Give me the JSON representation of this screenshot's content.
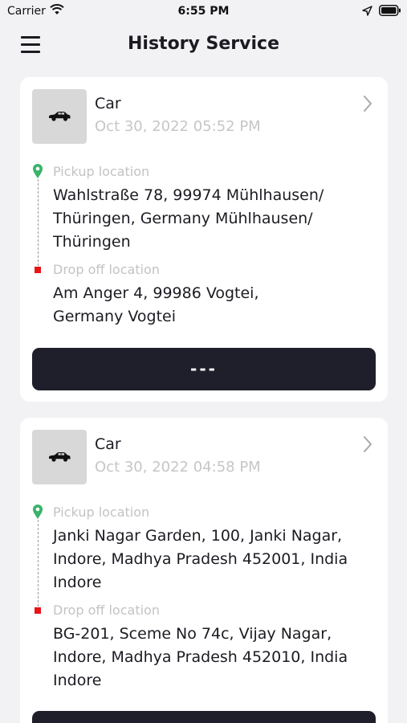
{
  "status_bar": {
    "carrier": "Carrier",
    "time": "6:55 PM"
  },
  "header": {
    "title": "History Service",
    "menu_icon": "hamburger-menu-icon"
  },
  "trips": [
    {
      "vehicle": "Car",
      "date": "Oct 30, 2022 05:52 PM",
      "pickup_label": "Pickup location",
      "pickup_address_lines": [
        "Wahlstraße 78, 99974 Mühlhausen/",
        "Thüringen, Germany Mühlhausen/",
        "Thüringen"
      ],
      "dropoff_label": "Drop off location",
      "dropoff_address_lines": [
        "Am Anger 4, 99986 Vogtei,",
        "Germany Vogtei"
      ],
      "action_label": "---"
    },
    {
      "vehicle": "Car",
      "date": "Oct 30, 2022 04:58 PM",
      "pickup_label": "Pickup location",
      "pickup_address_lines": [
        "Janki Nagar Garden, 100, Janki Nagar,",
        "Indore, Madhya Pradesh 452001, India",
        "Indore"
      ],
      "dropoff_label": "Drop off location",
      "dropoff_address_lines": [
        "BG-201, Sceme No 74c, Vijay Nagar,",
        "Indore, Madhya Pradesh 452010, India",
        "Indore"
      ],
      "action_label": ""
    }
  ],
  "colors": {
    "accent_dark": "#1f1e2b",
    "pickup_pin": "#3bb36b",
    "dropoff_marker": "#e8141a",
    "muted_text": "#c6c6c8"
  }
}
